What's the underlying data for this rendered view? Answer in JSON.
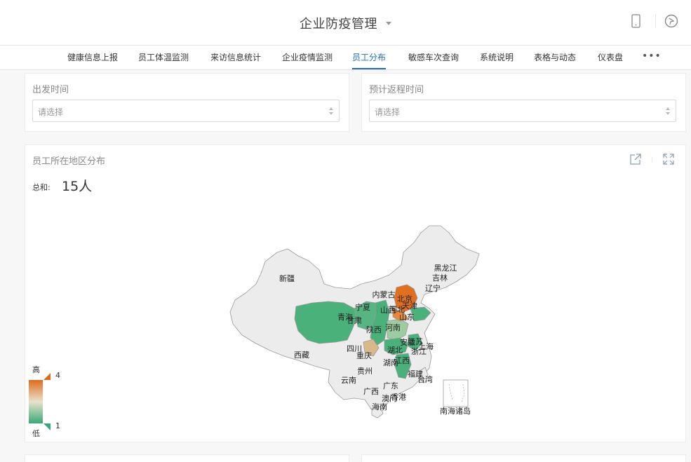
{
  "app": {
    "title": "企业防疫管理"
  },
  "tabs": [
    {
      "label": "健康信息上报",
      "active": false
    },
    {
      "label": "员工体温监测",
      "active": false
    },
    {
      "label": "来访信息统计",
      "active": false
    },
    {
      "label": "企业疫情监测",
      "active": false
    },
    {
      "label": "员工分布",
      "active": true
    },
    {
      "label": "敏感车次查询",
      "active": false
    },
    {
      "label": "系统说明",
      "active": false
    },
    {
      "label": "表格与动态",
      "active": false
    },
    {
      "label": "仪表盘",
      "active": false
    }
  ],
  "more_label": "•••",
  "filters": {
    "departure": {
      "label": "出发时间",
      "placeholder": "请选择"
    },
    "return": {
      "label": "预计返程时间",
      "placeholder": "请选择"
    }
  },
  "map_card": {
    "title": "员工所在地区分布",
    "total_label": "总和:",
    "total_value": "15人"
  },
  "legend": {
    "high_label": "高",
    "low_label": "低",
    "max": "4",
    "min": "1",
    "high_color": "#e06a1b",
    "low_color": "#3aa876"
  },
  "colors": {
    "accent": "#1f6fb2",
    "region_default": "#ececec",
    "region_border": "#9a9a9a"
  },
  "icons": {
    "phone": "mobile-phone-icon",
    "compass": "compass-icon",
    "share": "share-icon",
    "fullscreen": "fullscreen-icon"
  },
  "chart_data": {
    "type": "map",
    "title": "员工所在地区分布",
    "regions": [
      {
        "name": "黑龙江"
      },
      {
        "name": "吉林"
      },
      {
        "name": "辽宁"
      },
      {
        "name": "内蒙古"
      },
      {
        "name": "新疆"
      },
      {
        "name": "北京",
        "level": "high"
      },
      {
        "name": "天津"
      },
      {
        "name": "河北"
      },
      {
        "name": "山西"
      },
      {
        "name": "宁夏"
      },
      {
        "name": "甘肃"
      },
      {
        "name": "青海",
        "level": "low"
      },
      {
        "name": "山东"
      },
      {
        "name": "陕西"
      },
      {
        "name": "河南"
      },
      {
        "name": "西藏"
      },
      {
        "name": "四川"
      },
      {
        "name": "重庆"
      },
      {
        "name": "湖北"
      },
      {
        "name": "安徽"
      },
      {
        "name": "江苏"
      },
      {
        "name": "上海"
      },
      {
        "name": "浙江"
      },
      {
        "name": "湖南"
      },
      {
        "name": "江西"
      },
      {
        "name": "贵州"
      },
      {
        "name": "福建"
      },
      {
        "name": "台湾"
      },
      {
        "name": "云南"
      },
      {
        "name": "广西"
      },
      {
        "name": "广东"
      },
      {
        "name": "澳门"
      },
      {
        "name": "香港"
      },
      {
        "name": "海南"
      },
      {
        "name": "南海诸岛"
      }
    ],
    "legend_range": [
      1,
      4
    ]
  }
}
